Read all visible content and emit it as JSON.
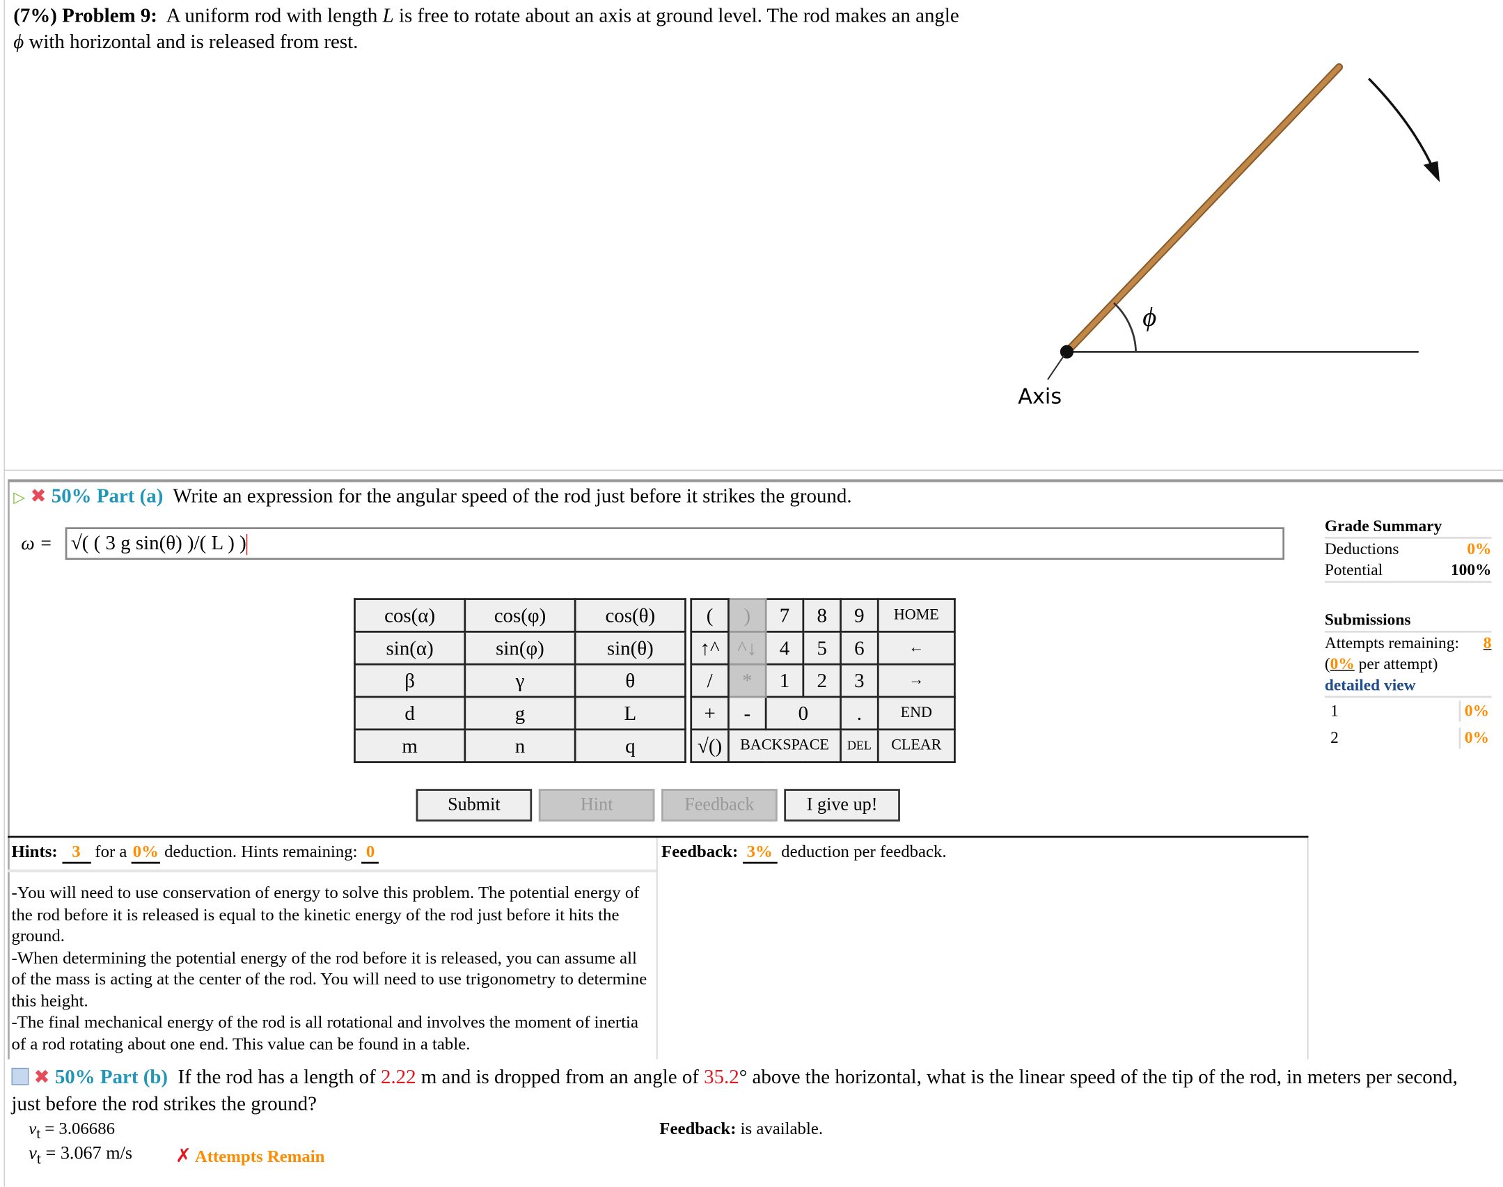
{
  "problem": {
    "weight": "(7%)",
    "label": "Problem 9:",
    "text_before": "A uniform rod with length",
    "var_L": "L",
    "text_mid": "is free to rotate about an axis at ground level. The rod makes an angle",
    "var_phi": "ϕ",
    "text_after": "with horizontal and is released from rest."
  },
  "figure": {
    "angle_label": "ϕ",
    "axis_label": "Axis",
    "rod_color": "#b07a3c"
  },
  "part_a": {
    "percent_label": "50% Part (a)",
    "question": "Write an expression for the angular speed of the rod just before it strikes the ground.",
    "symbol": "ω =",
    "answer_value": "√( ( 3 g sin(θ) )/( L ) )",
    "keypad_left": [
      [
        "cos(α)",
        "cos(φ)",
        "cos(θ)"
      ],
      [
        "sin(α)",
        "sin(φ)",
        "sin(θ)"
      ],
      [
        "β",
        "γ",
        "θ"
      ],
      [
        "d",
        "g",
        "L"
      ],
      [
        "m",
        "n",
        "q"
      ]
    ],
    "keypad_right": {
      "r1": [
        "(",
        ")",
        "7",
        "8",
        "9",
        "HOME"
      ],
      "r2": [
        "↑^",
        "^↓",
        "4",
        "5",
        "6",
        "←"
      ],
      "r3": [
        "/",
        "*",
        "1",
        "2",
        "3",
        "→"
      ],
      "r4": [
        "+",
        "-",
        "0",
        ".",
        "END"
      ],
      "r5": [
        "√()",
        "BACKSPACE",
        "DEL",
        "CLEAR"
      ]
    },
    "buttons": {
      "submit": "Submit",
      "hint": "Hint",
      "feedback": "Feedback",
      "give_up": "I give up!"
    },
    "hints": {
      "label": "Hints:",
      "count": "3",
      "for_a": "for a",
      "deduction": "0%",
      "deduction_text": "deduction. Hints remaining:",
      "remaining": "0",
      "body": [
        "-You will need to use conservation of energy to solve this problem. The potential energy of the rod before it is released is equal to the kinetic energy of the rod just before it hits the ground.",
        "-When determining the potential energy of the rod before it is released, you can assume all of the mass is acting at the center of the rod. You will need to use trigonometry to determine this height.",
        "-The final mechanical energy of the rod is all rotational and involves the moment of inertia of a rod rotating about one end. This value can be found in a table."
      ]
    },
    "feedback": {
      "label": "Feedback:",
      "value": "3%",
      "text": "deduction per feedback."
    }
  },
  "grade_summary": {
    "title": "Grade Summary",
    "deductions_label": "Deductions",
    "deductions_value": "0%",
    "potential_label": "Potential",
    "potential_value": "100%",
    "submissions_title": "Submissions",
    "attempts_label": "Attempts remaining:",
    "attempts_value": "8",
    "per_attempt_value": "0%",
    "per_attempt_text": "per attempt)",
    "detailed_view": "detailed view",
    "rows": [
      {
        "n": "1",
        "v": "0%"
      },
      {
        "n": "2",
        "v": "0%"
      }
    ]
  },
  "part_b": {
    "percent_label": "50% Part (b)",
    "q1": "If the rod has a length of",
    "length": "2.22",
    "q2": "m and is dropped from an angle of",
    "angle": "35.2",
    "q3": "° above the horizontal, what is the linear speed of the tip of the rod, in meters per second, just before the rod strikes the ground?",
    "vt_symbol": "v",
    "vt_sub": "t",
    "vt_value1": " = 3.06686",
    "vt_value2": " = 3.067 m/s",
    "status": "Attempts Remain",
    "feedback_label": "Feedback:",
    "feedback_text": "is available."
  },
  "colors": {
    "accent": "#2196b8",
    "orange": "#ff8c00",
    "red": "#e8141c"
  }
}
